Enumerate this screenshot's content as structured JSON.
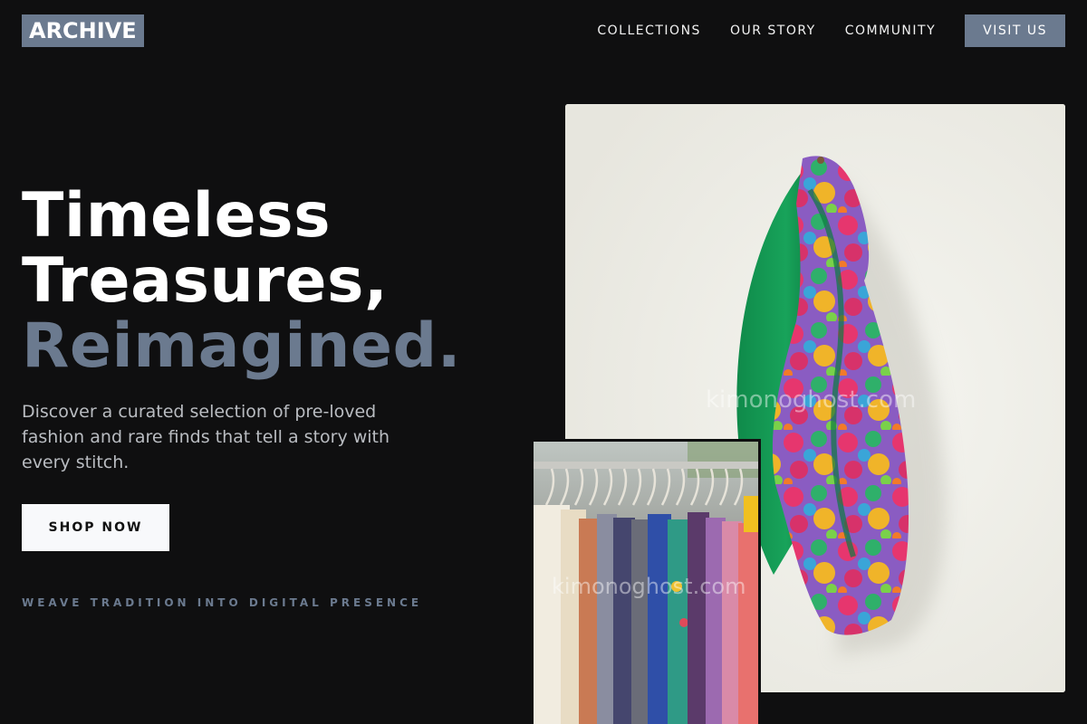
{
  "header": {
    "logo": "ARCHIVE",
    "nav": [
      {
        "label": "COLLECTIONS"
      },
      {
        "label": "OUR STORY"
      },
      {
        "label": "COMMUNITY"
      }
    ],
    "cta": "VISIT US"
  },
  "hero": {
    "title_line1": "Timeless",
    "title_line2": "Treasures,",
    "title_line3": "Reimagined.",
    "subtitle": "Discover a curated selection of pre-loved fashion and rare finds that tell a story with every stitch.",
    "button": "SHOP NOW",
    "tagline": "WEAVE TRADITION INTO DIGITAL PRESENCE"
  },
  "images": {
    "main_watermark": "kimonoghost.com",
    "secondary_watermark": "kimonoghost.com"
  },
  "colors": {
    "background": "#0f0f10",
    "accent": "#6b7a8f",
    "button_bg": "#f8f9fb"
  }
}
